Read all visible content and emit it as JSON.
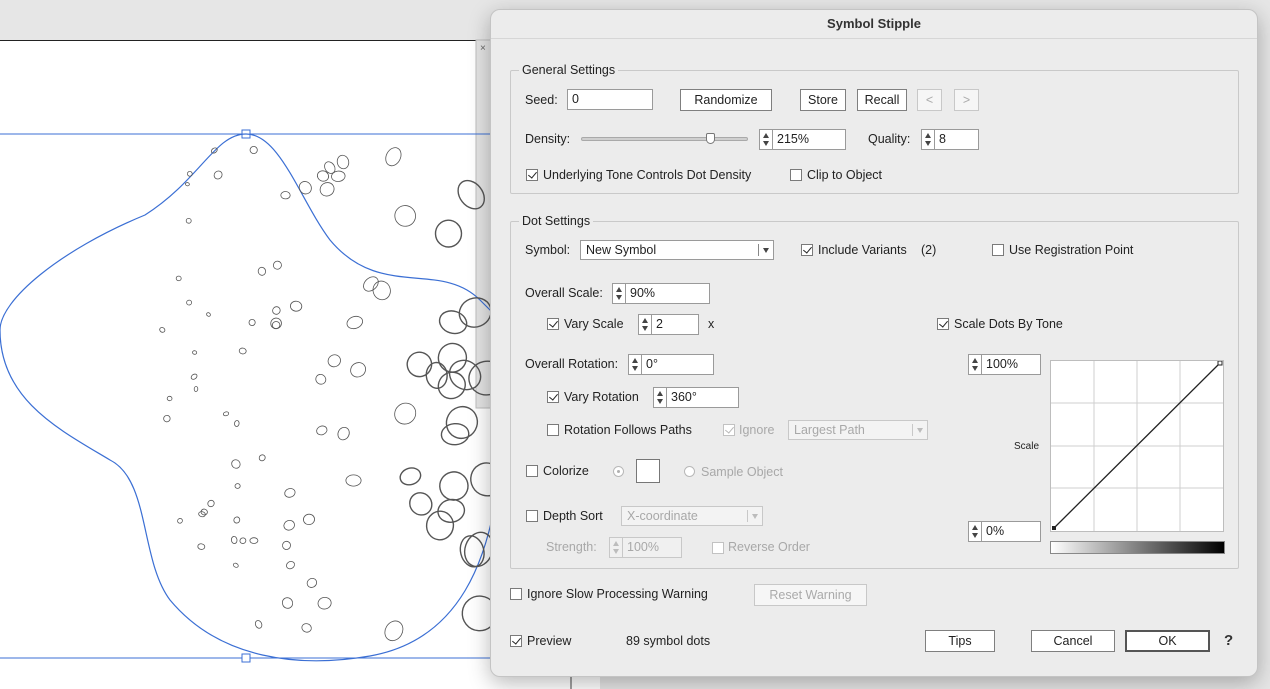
{
  "dialog": {
    "title": "Symbol Stipple",
    "general": {
      "legend": "General Settings",
      "seed_label": "Seed:",
      "seed_value": "0",
      "randomize": "Randomize",
      "store": "Store",
      "recall": "Recall",
      "prev": "<",
      "next": ">",
      "density_label": "Density:",
      "density_slider_fraction": 0.78,
      "density_value": "215%",
      "quality_label": "Quality:",
      "quality_value": "8",
      "tone_density": {
        "label": "Underlying Tone Controls Dot Density",
        "checked": true
      },
      "clip_object": {
        "label": "Clip to Object",
        "checked": false
      }
    },
    "dot": {
      "legend": "Dot Settings",
      "symbol_label": "Symbol:",
      "symbol_value": "New Symbol",
      "include_variants": {
        "label": "Include Variants",
        "checked": true
      },
      "variants_count": "(2)",
      "registration": {
        "label": "Use Registration Point",
        "checked": false
      },
      "overall_scale_label": "Overall Scale:",
      "overall_scale_value": "90%",
      "vary_scale": {
        "label": "Vary Scale",
        "checked": true
      },
      "vary_scale_value": "2",
      "vary_scale_unit": "x",
      "scale_by_tone": {
        "label": "Scale Dots By Tone",
        "checked": true
      },
      "overall_rotation_label": "Overall Rotation:",
      "overall_rotation_value": "0°",
      "vary_rotation": {
        "label": "Vary Rotation",
        "checked": true
      },
      "vary_rotation_value": "360°",
      "rotation_paths": {
        "label": "Rotation Follows Paths",
        "checked": false
      },
      "ignore": {
        "label": "Ignore",
        "checked": true
      },
      "ignore_value": "Largest Path",
      "colorize": {
        "label": "Colorize",
        "checked": false
      },
      "sample_object": "Sample Object",
      "depth_sort": {
        "label": "Depth Sort",
        "checked": false
      },
      "depth_sort_value": "X-coordinate",
      "strength_label": "Strength:",
      "strength_value": "100%",
      "reverse_order": {
        "label": "Reverse Order",
        "checked": false
      },
      "curve": {
        "max_value": "100%",
        "min_value": "0%",
        "axis_label": "Scale"
      }
    },
    "slow_warning": {
      "label": "Ignore Slow Processing Warning",
      "checked": false
    },
    "reset_warning": "Reset Warning",
    "preview": {
      "label": "Preview",
      "checked": true
    },
    "dot_count": "89 symbol dots",
    "tips": "Tips",
    "cancel": "Cancel",
    "ok": "OK",
    "help": "?"
  },
  "colors": {
    "selection_blue": "#3b6fd4",
    "dialog_bg": "#ececec"
  }
}
